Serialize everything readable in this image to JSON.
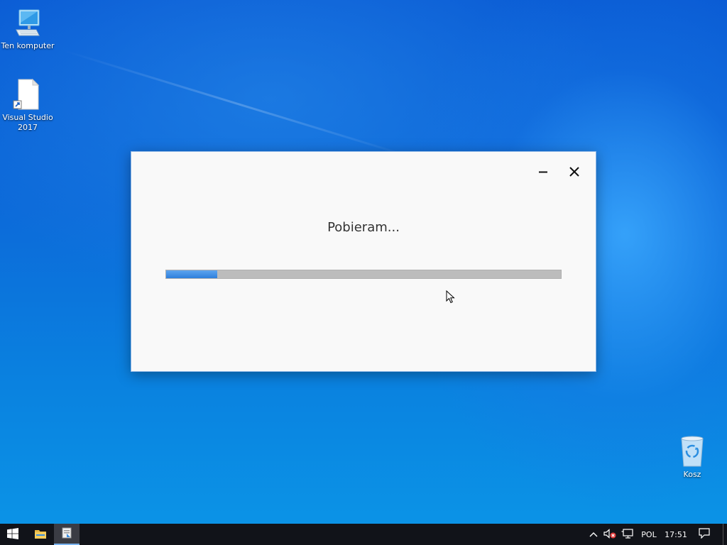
{
  "desktop": {
    "icons": [
      {
        "label": "Ten komputer",
        "icon": "computer-icon"
      },
      {
        "label": "Visual Studio 2017",
        "icon": "shortcut-file-icon"
      },
      {
        "label": "Kosz",
        "icon": "recycle-bin-icon"
      }
    ]
  },
  "dialog": {
    "title": "Pobieram...",
    "progress_fraction": 0.13,
    "minimize_icon": "minimize-icon",
    "close_icon": "close-icon"
  },
  "taskbar": {
    "start_icon": "windows-start-icon",
    "explorer_icon": "file-explorer-icon",
    "app_icon": "installer-app-icon",
    "tray": {
      "chevron_icon": "chevron-up-icon",
      "volume_icon": "volume-muted-icon",
      "network_icon": "network-icon",
      "language": "POL",
      "time": "17:51",
      "notifications_icon": "action-center-icon"
    }
  },
  "colors": {
    "accent": "#2e7fdc",
    "progress_track": "#bcbcbc",
    "taskbar": "#111319"
  }
}
